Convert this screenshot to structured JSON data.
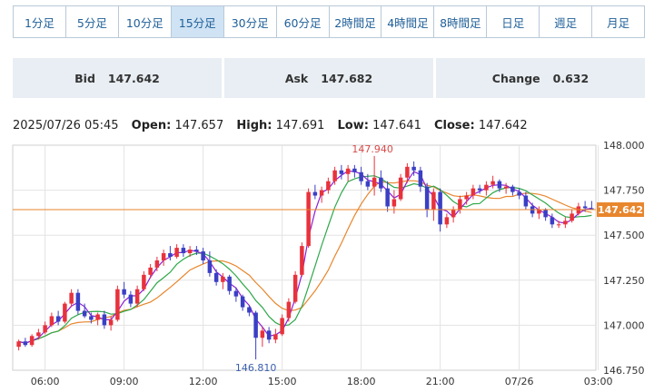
{
  "tabs": [
    {
      "label": "1分足",
      "active": false
    },
    {
      "label": "5分足",
      "active": false
    },
    {
      "label": "10分足",
      "active": false
    },
    {
      "label": "15分足",
      "active": true
    },
    {
      "label": "30分足",
      "active": false
    },
    {
      "label": "60分足",
      "active": false
    },
    {
      "label": "2時間足",
      "active": false
    },
    {
      "label": "4時間足",
      "active": false
    },
    {
      "label": "8時間足",
      "active": false
    },
    {
      "label": "日足",
      "active": false
    },
    {
      "label": "週足",
      "active": false
    },
    {
      "label": "月足",
      "active": false
    }
  ],
  "quote": {
    "bid_label": "Bid",
    "bid": "147.642",
    "ask_label": "Ask",
    "ask": "147.682",
    "change_label": "Change",
    "change": "0.632"
  },
  "ohlc": {
    "datetime": "2025/07/26 05:45",
    "open_label": "Open:",
    "open": "147.657",
    "high_label": "High:",
    "high": "147.691",
    "low_label": "Low:",
    "low": "147.641",
    "close_label": "Close:",
    "close": "147.642"
  },
  "colors": {
    "up": "#e8323c",
    "down": "#3a3fc4",
    "ma_short": "#8b1fd6",
    "ma_mid": "#2fa84a",
    "ma_long": "#e8862d",
    "price_line": "#e8862d",
    "grid": "#e3e3e3"
  },
  "chart_data": {
    "type": "candlestick",
    "ylim": [
      146.75,
      148.0
    ],
    "y_ticks": [
      "148.000",
      "147.750",
      "147.500",
      "147.250",
      "147.000",
      "146.750"
    ],
    "x_tick_labels": [
      "06:00",
      "09:00",
      "12:00",
      "15:00",
      "18:00",
      "21:00",
      "07/26",
      "03:00"
    ],
    "max_label": "147.940",
    "min_label": "146.810",
    "last_price": "147.642",
    "grid": true,
    "candles": [
      [
        146.88,
        146.92,
        146.86,
        146.91
      ],
      [
        146.91,
        146.93,
        146.88,
        146.89
      ],
      [
        146.89,
        146.95,
        146.88,
        146.94
      ],
      [
        146.94,
        146.98,
        146.92,
        146.96
      ],
      [
        146.96,
        147.02,
        146.95,
        147.0
      ],
      [
        147.0,
        147.07,
        146.99,
        147.05
      ],
      [
        147.05,
        147.08,
        147.0,
        147.02
      ],
      [
        147.02,
        147.13,
        147.01,
        147.12
      ],
      [
        147.12,
        147.2,
        147.1,
        147.18
      ],
      [
        147.18,
        147.2,
        147.06,
        147.08
      ],
      [
        147.08,
        147.12,
        147.04,
        147.05
      ],
      [
        147.05,
        147.07,
        147.01,
        147.03
      ],
      [
        147.03,
        147.07,
        147.0,
        147.06
      ],
      [
        147.06,
        147.08,
        146.98,
        147.0
      ],
      [
        147.0,
        147.05,
        146.97,
        147.03
      ],
      [
        147.03,
        147.22,
        147.02,
        147.2
      ],
      [
        147.2,
        147.24,
        147.15,
        147.17
      ],
      [
        147.17,
        147.19,
        147.1,
        147.12
      ],
      [
        147.12,
        147.22,
        147.1,
        147.2
      ],
      [
        147.2,
        147.3,
        147.19,
        147.28
      ],
      [
        147.28,
        147.34,
        147.26,
        147.32
      ],
      [
        147.32,
        147.38,
        147.3,
        147.36
      ],
      [
        147.36,
        147.42,
        147.33,
        147.4
      ],
      [
        147.4,
        147.44,
        147.36,
        147.38
      ],
      [
        147.38,
        147.45,
        147.37,
        147.43
      ],
      [
        147.43,
        147.45,
        147.38,
        147.4
      ],
      [
        147.4,
        147.44,
        147.38,
        147.42
      ],
      [
        147.42,
        147.44,
        147.39,
        147.41
      ],
      [
        147.41,
        147.43,
        147.34,
        147.36
      ],
      [
        147.36,
        147.41,
        147.27,
        147.29
      ],
      [
        147.29,
        147.31,
        147.22,
        147.24
      ],
      [
        147.24,
        147.29,
        147.2,
        147.27
      ],
      [
        147.27,
        147.28,
        147.17,
        147.19
      ],
      [
        147.19,
        147.21,
        147.13,
        147.16
      ],
      [
        147.16,
        147.17,
        147.08,
        147.1
      ],
      [
        147.1,
        147.11,
        147.05,
        147.07
      ],
      [
        147.07,
        147.08,
        146.81,
        146.93
      ],
      [
        146.93,
        146.99,
        146.88,
        146.97
      ],
      [
        146.97,
        146.99,
        146.9,
        146.92
      ],
      [
        146.92,
        146.98,
        146.9,
        146.95
      ],
      [
        146.95,
        147.06,
        146.94,
        147.04
      ],
      [
        147.04,
        147.15,
        147.02,
        147.13
      ],
      [
        147.13,
        147.3,
        147.12,
        147.28
      ],
      [
        147.28,
        147.46,
        147.27,
        147.44
      ],
      [
        147.44,
        147.76,
        147.43,
        147.74
      ],
      [
        147.74,
        147.78,
        147.7,
        147.72
      ],
      [
        147.72,
        147.77,
        147.68,
        147.75
      ],
      [
        147.75,
        147.82,
        147.73,
        147.8
      ],
      [
        147.8,
        147.88,
        147.78,
        147.86
      ],
      [
        147.86,
        147.89,
        147.81,
        147.84
      ],
      [
        147.84,
        147.89,
        147.8,
        147.87
      ],
      [
        147.87,
        147.89,
        147.82,
        147.85
      ],
      [
        147.85,
        147.88,
        147.78,
        147.8
      ],
      [
        147.8,
        147.84,
        147.75,
        147.77
      ],
      [
        147.77,
        147.94,
        147.72,
        147.82
      ],
      [
        147.82,
        147.86,
        147.74,
        147.76
      ],
      [
        147.76,
        147.8,
        147.63,
        147.66
      ],
      [
        147.66,
        147.75,
        147.62,
        147.7
      ],
      [
        147.7,
        147.84,
        147.69,
        147.82
      ],
      [
        147.82,
        147.9,
        147.79,
        147.88
      ],
      [
        147.88,
        147.91,
        147.83,
        147.86
      ],
      [
        147.86,
        147.88,
        147.74,
        147.77
      ],
      [
        147.77,
        147.79,
        147.6,
        147.64
      ],
      [
        147.64,
        147.76,
        147.58,
        147.74
      ],
      [
        147.74,
        147.76,
        147.52,
        147.56
      ],
      [
        147.56,
        147.62,
        147.54,
        147.6
      ],
      [
        147.6,
        147.66,
        147.57,
        147.64
      ],
      [
        147.64,
        147.72,
        147.62,
        147.7
      ],
      [
        147.7,
        147.74,
        147.67,
        147.72
      ],
      [
        147.72,
        147.78,
        147.7,
        147.76
      ],
      [
        147.76,
        147.78,
        147.73,
        147.75
      ],
      [
        147.75,
        147.8,
        147.72,
        147.78
      ],
      [
        147.78,
        147.83,
        147.76,
        147.8
      ],
      [
        147.8,
        147.81,
        147.74,
        147.76
      ],
      [
        147.76,
        147.79,
        147.73,
        147.77
      ],
      [
        147.77,
        147.78,
        147.72,
        147.74
      ],
      [
        147.74,
        147.76,
        147.7,
        147.72
      ],
      [
        147.72,
        147.74,
        147.64,
        147.66
      ],
      [
        147.66,
        147.68,
        147.6,
        147.62
      ],
      [
        147.62,
        147.66,
        147.59,
        147.64
      ],
      [
        147.64,
        147.65,
        147.58,
        147.6
      ],
      [
        147.6,
        147.62,
        147.54,
        147.56
      ],
      [
        147.56,
        147.58,
        147.54,
        147.56
      ],
      [
        147.56,
        147.6,
        147.54,
        147.58
      ],
      [
        147.58,
        147.64,
        147.57,
        147.62
      ],
      [
        147.62,
        147.68,
        147.61,
        147.66
      ],
      [
        147.66,
        147.69,
        147.63,
        147.65
      ],
      [
        147.65,
        147.69,
        147.64,
        147.64
      ]
    ]
  }
}
